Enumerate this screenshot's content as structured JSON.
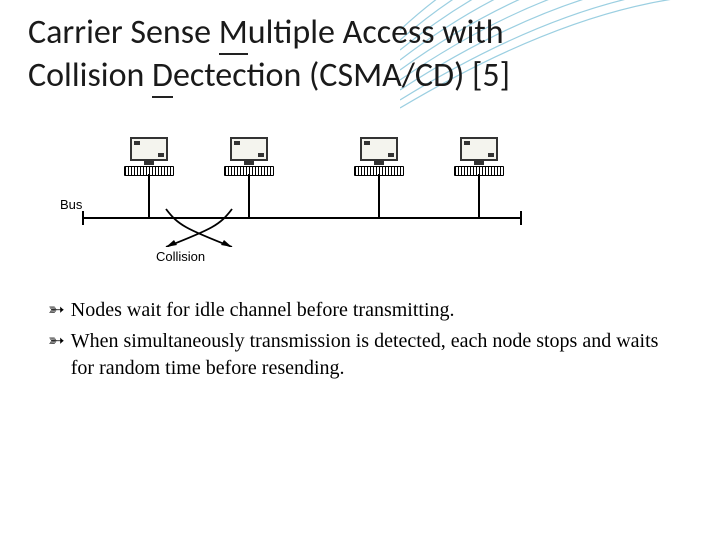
{
  "title": {
    "line1_prefix": "Carrier Sense ",
    "line1_under": "M",
    "line1_suffix": "ultiple Access with",
    "line2_prefix": "Collision ",
    "line2_under": "D",
    "line2_suffix": "ectection (CSMA/CD) [5]"
  },
  "diagram": {
    "bus_label": "Bus",
    "collision_label": "Collision"
  },
  "bullets": [
    "Nodes wait for idle channel before transmitting.",
    "When simultaneously transmission is detected, each node stops and waits for random time before resending."
  ],
  "colors": {
    "wave_stroke": "#4aa8c9"
  }
}
